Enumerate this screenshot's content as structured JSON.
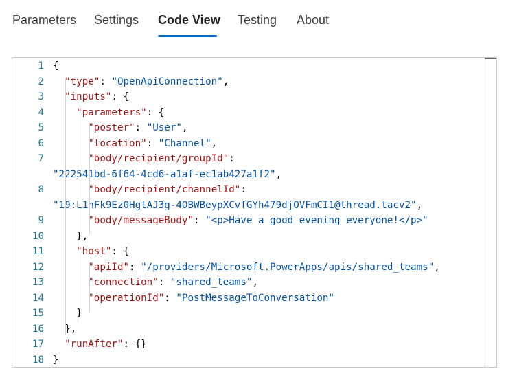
{
  "tabs": {
    "parameters": "Parameters",
    "settings": "Settings",
    "code_view": "Code View",
    "testing": "Testing",
    "about": "About",
    "active": "Code View"
  },
  "code": {
    "lines": [
      {
        "n": "1",
        "parts": [
          [
            "p",
            "{"
          ]
        ]
      },
      {
        "n": "2",
        "parts": [
          [
            "p",
            "  "
          ],
          [
            "k",
            "\"type\""
          ],
          [
            "p",
            ": "
          ],
          [
            "s",
            "\"OpenApiConnection\""
          ],
          [
            "p",
            ","
          ]
        ]
      },
      {
        "n": "3",
        "parts": [
          [
            "p",
            "  "
          ],
          [
            "k",
            "\"inputs\""
          ],
          [
            "p",
            ": {"
          ]
        ]
      },
      {
        "n": "4",
        "parts": [
          [
            "p",
            "    "
          ],
          [
            "k",
            "\"parameters\""
          ],
          [
            "p",
            ": {"
          ]
        ]
      },
      {
        "n": "5",
        "parts": [
          [
            "p",
            "      "
          ],
          [
            "k",
            "\"poster\""
          ],
          [
            "p",
            ": "
          ],
          [
            "s",
            "\"User\""
          ],
          [
            "p",
            ","
          ]
        ]
      },
      {
        "n": "6",
        "parts": [
          [
            "p",
            "      "
          ],
          [
            "k",
            "\"location\""
          ],
          [
            "p",
            ": "
          ],
          [
            "s",
            "\"Channel\""
          ],
          [
            "p",
            ","
          ]
        ]
      },
      {
        "n": "7",
        "parts": [
          [
            "p",
            "      "
          ],
          [
            "k",
            "\"body/recipient/groupId\""
          ],
          [
            "p",
            ":"
          ]
        ]
      },
      {
        "n": "",
        "parts": [
          [
            "s",
            "\"222541bd-6f64-4cd6-a1af-ec1ab427a1f2\""
          ],
          [
            "p",
            ","
          ]
        ]
      },
      {
        "n": "8",
        "parts": [
          [
            "p",
            "      "
          ],
          [
            "k",
            "\"body/recipient/channelId\""
          ],
          [
            "p",
            ":"
          ]
        ]
      },
      {
        "n": "",
        "parts": [
          [
            "s",
            "\"19:L1hFk9Ez0HgtAJ3g-4OBWBeypXCvfGYh479djOVFmCI1@thread.tacv2\""
          ],
          [
            "p",
            ","
          ]
        ]
      },
      {
        "n": "9",
        "parts": [
          [
            "p",
            "      "
          ],
          [
            "k",
            "\"body/messageBody\""
          ],
          [
            "p",
            ": "
          ],
          [
            "s",
            "\"<p>Have a good evening everyone!</p>\""
          ]
        ]
      },
      {
        "n": "10",
        "parts": [
          [
            "p",
            "    },"
          ]
        ]
      },
      {
        "n": "11",
        "parts": [
          [
            "p",
            "    "
          ],
          [
            "k",
            "\"host\""
          ],
          [
            "p",
            ": {"
          ]
        ]
      },
      {
        "n": "12",
        "parts": [
          [
            "p",
            "      "
          ],
          [
            "k",
            "\"apiId\""
          ],
          [
            "p",
            ": "
          ],
          [
            "s",
            "\"/providers/Microsoft.PowerApps/apis/shared_teams\""
          ],
          [
            "p",
            ","
          ]
        ]
      },
      {
        "n": "13",
        "parts": [
          [
            "p",
            "      "
          ],
          [
            "k",
            "\"connection\""
          ],
          [
            "p",
            ": "
          ],
          [
            "s",
            "\"shared_teams\""
          ],
          [
            "p",
            ","
          ]
        ]
      },
      {
        "n": "14",
        "parts": [
          [
            "p",
            "      "
          ],
          [
            "k",
            "\"operationId\""
          ],
          [
            "p",
            ": "
          ],
          [
            "s",
            "\"PostMessageToConversation\""
          ]
        ]
      },
      {
        "n": "15",
        "parts": [
          [
            "p",
            "    }"
          ]
        ]
      },
      {
        "n": "16",
        "parts": [
          [
            "p",
            "  },"
          ]
        ]
      },
      {
        "n": "17",
        "parts": [
          [
            "p",
            "  "
          ],
          [
            "k",
            "\"runAfter\""
          ],
          [
            "p",
            ": {}"
          ]
        ]
      },
      {
        "n": "18",
        "parts": [
          [
            "p",
            "}"
          ]
        ]
      }
    ]
  },
  "colors": {
    "accent": "#0f6cbd",
    "json_key": "#a31515",
    "json_string": "#0451a5",
    "line_number": "#237893"
  }
}
